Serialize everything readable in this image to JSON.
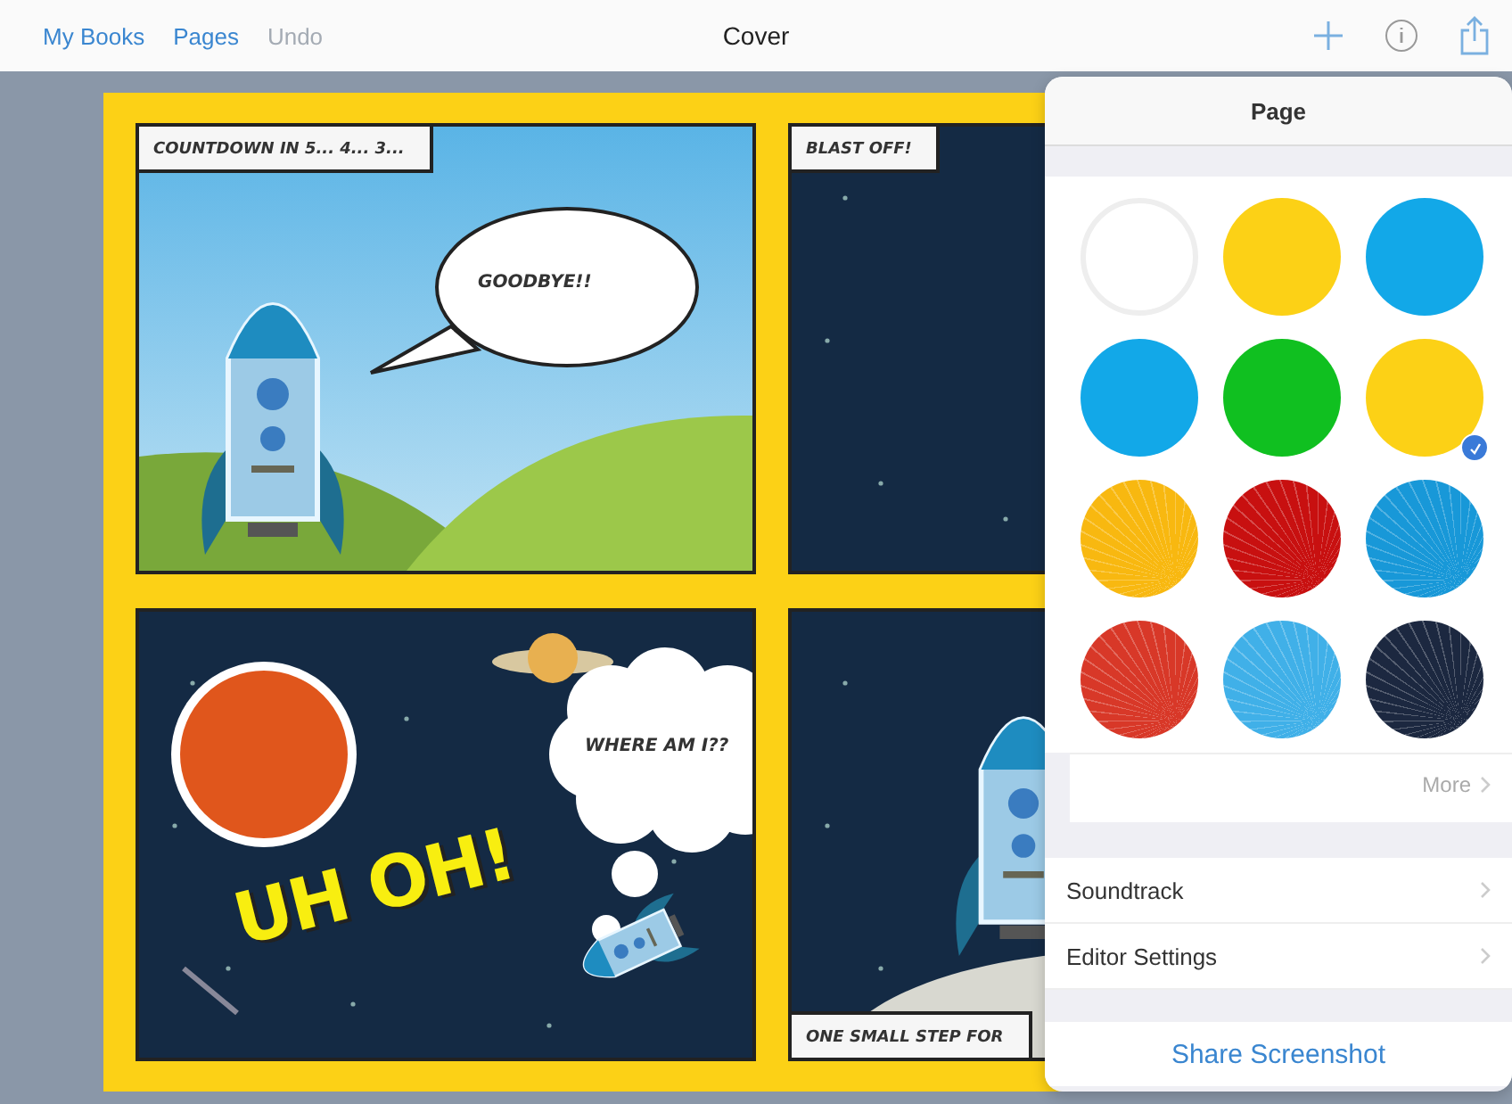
{
  "toolbar": {
    "left_buttons": [
      {
        "label": "My Books",
        "disabled": false
      },
      {
        "label": "Pages",
        "disabled": false
      },
      {
        "label": "Undo",
        "disabled": true
      }
    ],
    "title": "Cover"
  },
  "comic": {
    "panels": [
      {
        "kind": "sky",
        "caption": "COUNTDOWN IN 5... 4... 3...",
        "speech": "GOODBYE!!"
      },
      {
        "kind": "space",
        "caption": "BLAST OFF!"
      },
      {
        "kind": "lost",
        "thought": "WHERE AM I??",
        "sound": "UH OH!"
      },
      {
        "kind": "moon",
        "caption": "ONE SMALL STEP FOR"
      }
    ]
  },
  "popover": {
    "title": "Page",
    "swatches": [
      {
        "kind": "solid",
        "color": "#ffffff",
        "selected": false
      },
      {
        "kind": "solid",
        "color": "#fcd116",
        "selected": false
      },
      {
        "kind": "solid",
        "color": "#12a8e8",
        "selected": false
      },
      {
        "kind": "solid",
        "color": "#12a8e8",
        "selected": false
      },
      {
        "kind": "solid",
        "color": "#10c020",
        "selected": false
      },
      {
        "kind": "solid",
        "color": "#fcd116",
        "selected": true
      },
      {
        "kind": "rays",
        "color": "#f8b810",
        "selected": false
      },
      {
        "kind": "rays",
        "color": "#c81010",
        "selected": false
      },
      {
        "kind": "rays",
        "color": "#1898d8",
        "selected": false
      },
      {
        "kind": "rays",
        "color": "#d83828",
        "selected": false
      },
      {
        "kind": "rays",
        "color": "#40b0e8",
        "selected": false
      },
      {
        "kind": "rays",
        "color": "#1c2840",
        "selected": false
      }
    ],
    "more": "More",
    "rows": [
      "Soundtrack",
      "Editor Settings"
    ],
    "share": "Share Screenshot"
  }
}
